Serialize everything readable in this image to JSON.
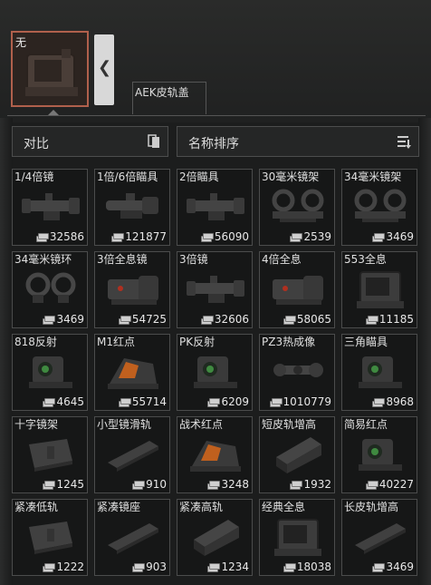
{
  "equipped": {
    "label": "无",
    "icon": "holographic-sight-icon"
  },
  "slot": {
    "label": "AEK皮轨盖"
  },
  "toolbar": {
    "compare_label": "对比",
    "sort_label": "名称排序"
  },
  "colors": {
    "equipped_border": "#b0604c",
    "cell_border": "#4b4c4c",
    "panel_bg": "#1c1d1d"
  },
  "items": [
    {
      "name": "1/4倍镜",
      "price": "32586",
      "icon": "scope-icon"
    },
    {
      "name": "1倍/6倍瞄具",
      "price": "121877",
      "icon": "variable-scope-icon"
    },
    {
      "name": "2倍瞄具",
      "price": "56090",
      "icon": "scope-icon"
    },
    {
      "name": "30毫米镜架",
      "price": "2539",
      "icon": "scope-mount-icon"
    },
    {
      "name": "34毫米镜架",
      "price": "3469",
      "icon": "scope-mount-icon"
    },
    {
      "name": "34毫米镜环",
      "price": "3469",
      "icon": "scope-ring-icon"
    },
    {
      "name": "3倍全息镜",
      "price": "54725",
      "icon": "holo-magnifier-icon"
    },
    {
      "name": "3倍镜",
      "price": "32606",
      "icon": "scope-icon"
    },
    {
      "name": "4倍全息",
      "price": "58065",
      "icon": "holo-magnifier-icon"
    },
    {
      "name": "553全息",
      "price": "11185",
      "icon": "holographic-sight-icon"
    },
    {
      "name": "818反射",
      "price": "4645",
      "icon": "reflex-sight-icon"
    },
    {
      "name": "M1红点",
      "price": "55714",
      "icon": "red-dot-icon"
    },
    {
      "name": "PK反射",
      "price": "6209",
      "icon": "reflex-sight-icon"
    },
    {
      "name": "PZ3热成像",
      "price": "1010779",
      "icon": "thermal-scope-icon"
    },
    {
      "name": "三角瞄具",
      "price": "8968",
      "icon": "reflex-sight-icon"
    },
    {
      "name": "十字镜架",
      "price": "1245",
      "icon": "rail-mount-icon"
    },
    {
      "name": "小型镜滑轨",
      "price": "910",
      "icon": "rail-icon"
    },
    {
      "name": "战术红点",
      "price": "3248",
      "icon": "red-dot-icon"
    },
    {
      "name": "短皮轨增高",
      "price": "1932",
      "icon": "riser-icon"
    },
    {
      "name": "简易红点",
      "price": "40227",
      "icon": "reflex-sight-icon"
    },
    {
      "name": "紧凑低轨",
      "price": "1222",
      "icon": "rail-mount-icon"
    },
    {
      "name": "紧凑镜座",
      "price": "903",
      "icon": "rail-icon"
    },
    {
      "name": "紧凑高轨",
      "price": "1234",
      "icon": "riser-icon"
    },
    {
      "name": "经典全息",
      "price": "18038",
      "icon": "holographic-sight-icon"
    },
    {
      "name": "长皮轨增高",
      "price": "3469",
      "icon": "rail-icon"
    }
  ]
}
